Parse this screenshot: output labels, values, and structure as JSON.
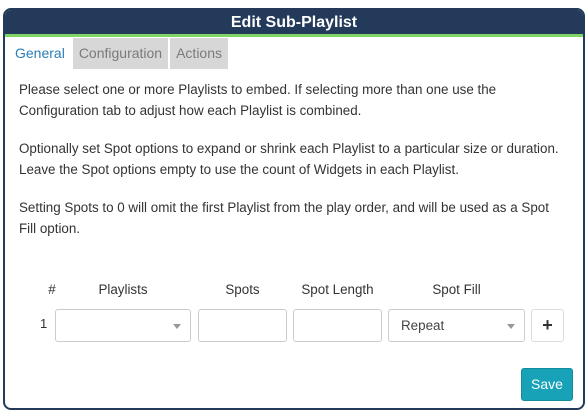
{
  "dialog": {
    "title": "Edit Sub-Playlist"
  },
  "tabs": [
    {
      "label": "General",
      "active": true
    },
    {
      "label": "Configuration",
      "active": false
    },
    {
      "label": "Actions",
      "active": false
    }
  ],
  "general": {
    "paragraphs": [
      "Please select one or more Playlists to embed. If selecting more than one use the Configuration tab to adjust how each Playlist is combined.",
      "Optionally set Spot options to expand or shrink each Playlist to a particular size or duration. Leave the Spot options empty to use the count of Widgets in each Playlist.",
      "Setting Spots to 0 will omit the first Playlist from the play order, and will be used as a Spot Fill option."
    ]
  },
  "table": {
    "headers": {
      "index": "#",
      "playlists": "Playlists",
      "spots": "Spots",
      "spot_length": "Spot Length",
      "spot_fill": "Spot Fill"
    },
    "rows": [
      {
        "index": "1",
        "playlist": "",
        "spots": "",
        "spot_length": "",
        "spot_fill": "Repeat"
      }
    ],
    "add_icon": "+"
  },
  "footer": {
    "save_label": "Save"
  },
  "colors": {
    "header_bg": "#233a5a",
    "header_accent": "#7fd466",
    "active_tab": "#2a7fb8",
    "save_button": "#17a2b8"
  }
}
